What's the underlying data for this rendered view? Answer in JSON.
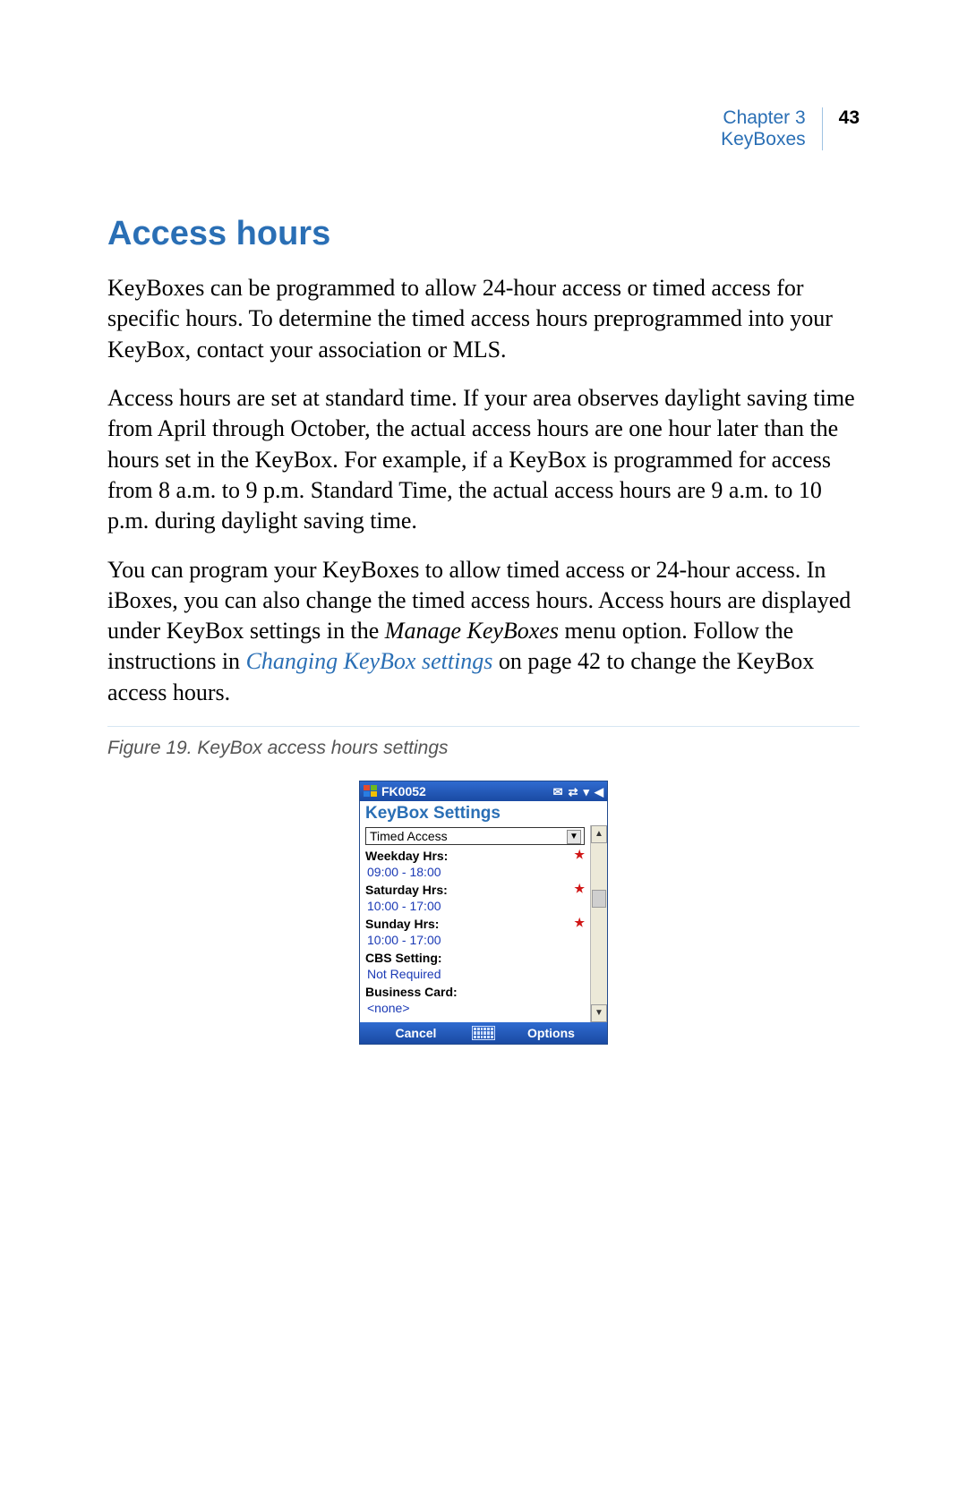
{
  "runhead": {
    "chapter_line1": "Chapter 3",
    "chapter_line2": "KeyBoxes",
    "page_number": "43"
  },
  "heading": "Access hours",
  "para1": "KeyBoxes can be programmed to allow 24-hour access or timed access for specific hours.  To determine the timed access hours preprogrammed into your KeyBox, contact your association or MLS.",
  "para2": "Access hours are set at standard time.  If your area observes daylight saving time from April through October, the actual access hours are one hour later than the hours set in the KeyBox.  For example, if a KeyBox is programmed for access from 8 a.m. to 9 p.m. Standard Time, the actual access hours are 9 a.m. to 10 p.m. during daylight saving time.",
  "para3_a": "You can program your KeyBoxes to allow timed access or 24-hour access.  In iBoxes, you can also change the timed access hours.  Access hours are displayed under KeyBox settings in the ",
  "para3_em": "Manage KeyBoxes",
  "para3_b": " menu option.  Follow the instructions in ",
  "para3_link": "Changing KeyBox settings",
  "para3_c": " on page 42 to change the KeyBox access hours.",
  "figure_caption": "Figure 19.  KeyBox access hours settings",
  "device": {
    "title": "FK0052",
    "heading": "KeyBox Settings",
    "select_value": "Timed Access",
    "rows": [
      {
        "label": "Weekday Hrs:",
        "value": "09:00 - 18:00",
        "star": true
      },
      {
        "label": "Saturday Hrs:",
        "value": "10:00 - 17:00",
        "star": true
      },
      {
        "label": "Sunday Hrs:",
        "value": "10:00 - 17:00",
        "star": true
      },
      {
        "label": "CBS Setting:",
        "value": "Not Required",
        "star": false
      },
      {
        "label": "Business Card:",
        "value": "<none>",
        "star": false
      }
    ],
    "footer_left": "Cancel",
    "footer_right": "Options"
  }
}
